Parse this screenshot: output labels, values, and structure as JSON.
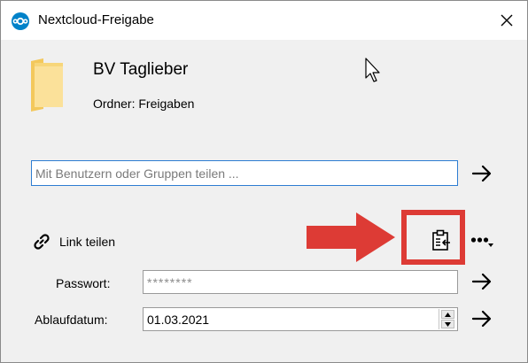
{
  "window": {
    "title": "Nextcloud-Freigabe",
    "app_icon": "nextcloud-logo-icon",
    "close_icon": "close-icon"
  },
  "share": {
    "name": "BV Taglieber",
    "kind": "Ordner: Freigaben",
    "icon": "folder-icon"
  },
  "search": {
    "placeholder": "Mit Benutzern oder Gruppen teilen ...",
    "value": ""
  },
  "link": {
    "label": "Link teilen",
    "icon": "link-icon",
    "copy_icon": "clipboard-icon",
    "more_icon": "more-options-icon"
  },
  "password": {
    "label": "Passwort:",
    "placeholder": "********",
    "value": ""
  },
  "expiry": {
    "label": "Ablaufdatum:",
    "value": "01.03.2021"
  },
  "annotation": {
    "color": "#dd3b35"
  },
  "colors": {
    "accent": "#0082c9",
    "input_focus": "#2d7dd2"
  }
}
